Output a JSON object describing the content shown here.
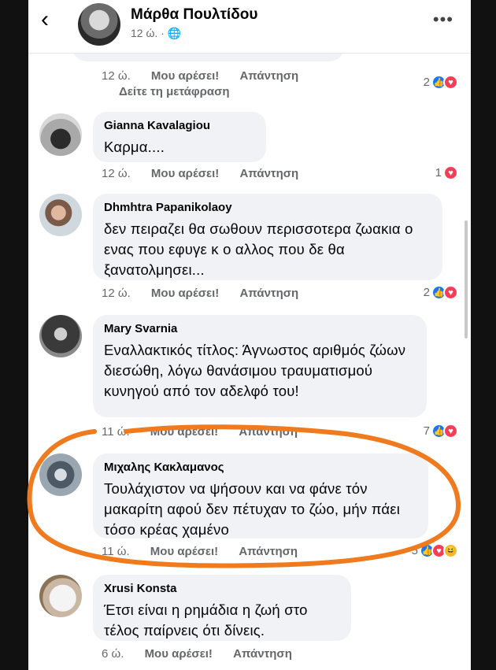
{
  "header": {
    "name": "Μάρθα Πουλτίδου",
    "meta": "12 ώ. · 🌐",
    "back_glyph": "‹",
    "more_glyph": "•••"
  },
  "top_actions": {
    "time": "12 ώ.",
    "like": "Μου αρέσει!",
    "reply": "Απάντηση",
    "translate": "Δείτε τη μετάφραση",
    "reaction_count": "2"
  },
  "comments": [
    {
      "author": "Gianna Kavalagiou",
      "text": "Καρμα....",
      "time": "12 ώ.",
      "like": "Μου αρέσει!",
      "reply": "Απάντηση",
      "reaction_count": "1"
    },
    {
      "author": "Dhmhtra Papanikolaoy",
      "text": "δεν πειραζει θα σωθουν περισσοτερα ζωακια ο ενας που εφυγε κ ο αλλος που δε θα ξανατολμησει...",
      "time": "12 ώ.",
      "like": "Μου αρέσει!",
      "reply": "Απάντηση",
      "reaction_count": "2"
    },
    {
      "author": "Mary Svarnia",
      "text": "Εναλλακτικός τίτλος: Άγνωστος αριθμός ζώων διεσώθη, λόγω θανάσιμου τραυματισμού κυνηγού από τον αδελφό του!",
      "time": "11 ώ.",
      "like": "Μου αρέσει!",
      "reply": "Απάντηση",
      "reaction_count": "7"
    },
    {
      "author": "Μιχαλης Κακλαμανος",
      "text": "Τουλάχιστον να ψήσουν και να φάνε τόν μακαρίτη αφού δεν πέτυχαν το ζώο, μήν πάει τόσο κρέας χαμένο",
      "time": "11 ώ.",
      "like": "Μου αρέσει!",
      "reply": "Απάντηση",
      "reaction_count": "5"
    },
    {
      "author": "Xrusi Konsta",
      "text": "Έτσι είναι η ρημάδια η ζωή στο τέλος παίρνεις ότι δίνεις.",
      "time": "6 ώ.",
      "like": "Μου αρέσει!",
      "reply": "Απάντηση"
    }
  ],
  "colors": {
    "like_blue": "#1877f2",
    "love_red": "#f33e58",
    "haha_yellow": "#f7b928",
    "annotation_orange": "#f07a1e",
    "bubble_gray": "#f0f2f5"
  }
}
